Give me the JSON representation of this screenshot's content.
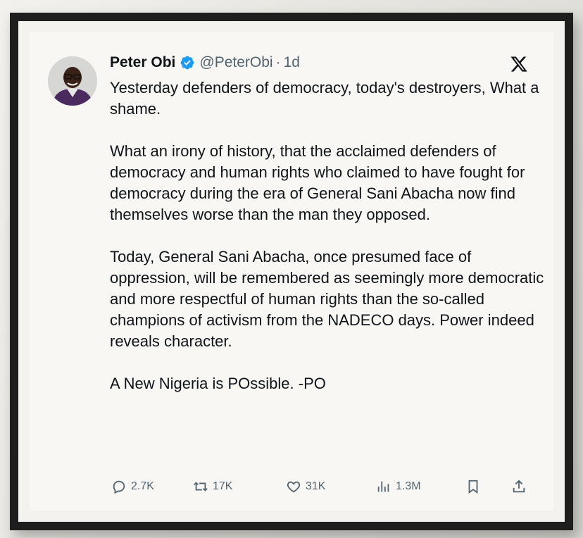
{
  "tweet": {
    "author_name": "Peter Obi",
    "handle": "@PeterObi",
    "separator": "·",
    "time": "1d",
    "paragraphs": [
      "Yesterday defenders of democracy, today's destroyers, What a shame.",
      "What an irony of history, that the acclaimed defenders of democracy and human rights who claimed to have fought for democracy during the era of General Sani Abacha now find themselves worse than the man they opposed.",
      "Today, General Sani Abacha, once presumed face of oppression, will be remembered as seemingly more democratic and more respectful of human rights than the so-called champions of activism from the NADECO days. Power indeed reveals character.",
      "A New Nigeria is POssible. -PO"
    ]
  },
  "stats": {
    "replies": "2.7K",
    "reposts": "17K",
    "likes": "31K",
    "views": "1.3M"
  },
  "icons": {
    "verified": "verified-badge-icon",
    "platform": "x-logo-icon",
    "reply": "reply-icon",
    "repost": "repost-icon",
    "like": "heart-icon",
    "views": "views-icon",
    "bookmark": "bookmark-icon",
    "share": "share-icon"
  },
  "colors": {
    "verified_blue": "#1d9bf0",
    "frame": "#1e1e1e",
    "text": "#0f1419",
    "muted": "#536471"
  }
}
